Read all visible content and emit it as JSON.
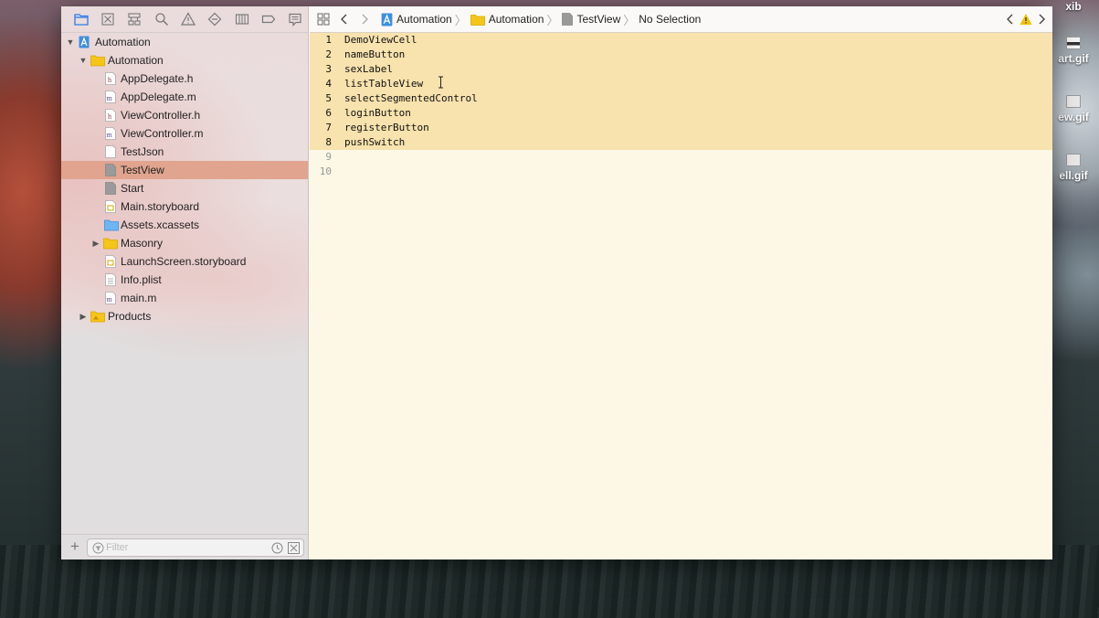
{
  "desktop": {
    "files": [
      {
        "label": "xib"
      },
      {
        "label": "art.gif"
      },
      {
        "label": "ew.gif"
      },
      {
        "label": "ell.gif"
      }
    ]
  },
  "navigator": {
    "tabs": [
      {
        "icon": "folder-icon"
      },
      {
        "icon": "source-control-icon"
      },
      {
        "icon": "symbol-hierarchy-icon"
      },
      {
        "icon": "search-icon"
      },
      {
        "icon": "warning-icon"
      },
      {
        "icon": "test-diamond-icon"
      },
      {
        "icon": "debug-icon"
      },
      {
        "icon": "breakpoint-icon"
      },
      {
        "icon": "report-icon"
      }
    ],
    "tree": [
      {
        "label": "Automation",
        "icon": "project-icon"
      },
      {
        "label": "Automation",
        "icon": "folder-icon"
      },
      {
        "label": "AppDelegate.h",
        "icon": "header-file-icon"
      },
      {
        "label": "AppDelegate.m",
        "icon": "implementation-file-icon"
      },
      {
        "label": "ViewController.h",
        "icon": "header-file-icon"
      },
      {
        "label": "ViewController.m",
        "icon": "implementation-file-icon"
      },
      {
        "label": "TestJson",
        "icon": "plain-file-icon"
      },
      {
        "label": "TestView",
        "icon": "plain-file-icon"
      },
      {
        "label": "Start",
        "icon": "plain-file-icon"
      },
      {
        "label": "Main.storyboard",
        "icon": "storyboard-icon"
      },
      {
        "label": "Assets.xcassets",
        "icon": "asset-folder-icon"
      },
      {
        "label": "Masonry",
        "icon": "folder-icon"
      },
      {
        "label": "LaunchScreen.storyboard",
        "icon": "storyboard-icon"
      },
      {
        "label": "Info.plist",
        "icon": "plist-icon"
      },
      {
        "label": "main.m",
        "icon": "implementation-file-icon"
      },
      {
        "label": "Products",
        "icon": "folder-icon"
      }
    ],
    "filter_placeholder": "Filter"
  },
  "jumpbar": {
    "crumbs": [
      "Automation",
      "Automation",
      "TestView",
      "No Selection"
    ]
  },
  "editor": {
    "lines": [
      {
        "number": "1",
        "text": "DemoViewCell"
      },
      {
        "number": "2",
        "text": "nameButton"
      },
      {
        "number": "3",
        "text": "sexLabel"
      },
      {
        "number": "4",
        "text": "listTableView"
      },
      {
        "number": "5",
        "text": "selectSegmentedControl"
      },
      {
        "number": "6",
        "text": "loginButton"
      },
      {
        "number": "7",
        "text": "registerButton"
      },
      {
        "number": "8",
        "text": "pushSwitch"
      },
      {
        "number": "9",
        "text": ""
      },
      {
        "number": "10",
        "text": ""
      }
    ]
  },
  "colors": {
    "selection_row": "#e0a48f",
    "code_selection": "#f8e2ad",
    "editor_background": "#fdf8e6",
    "folder_yellow": "#f5c518",
    "project_blue": "#3f8fe0",
    "warning_yellow": "#f2c200"
  }
}
